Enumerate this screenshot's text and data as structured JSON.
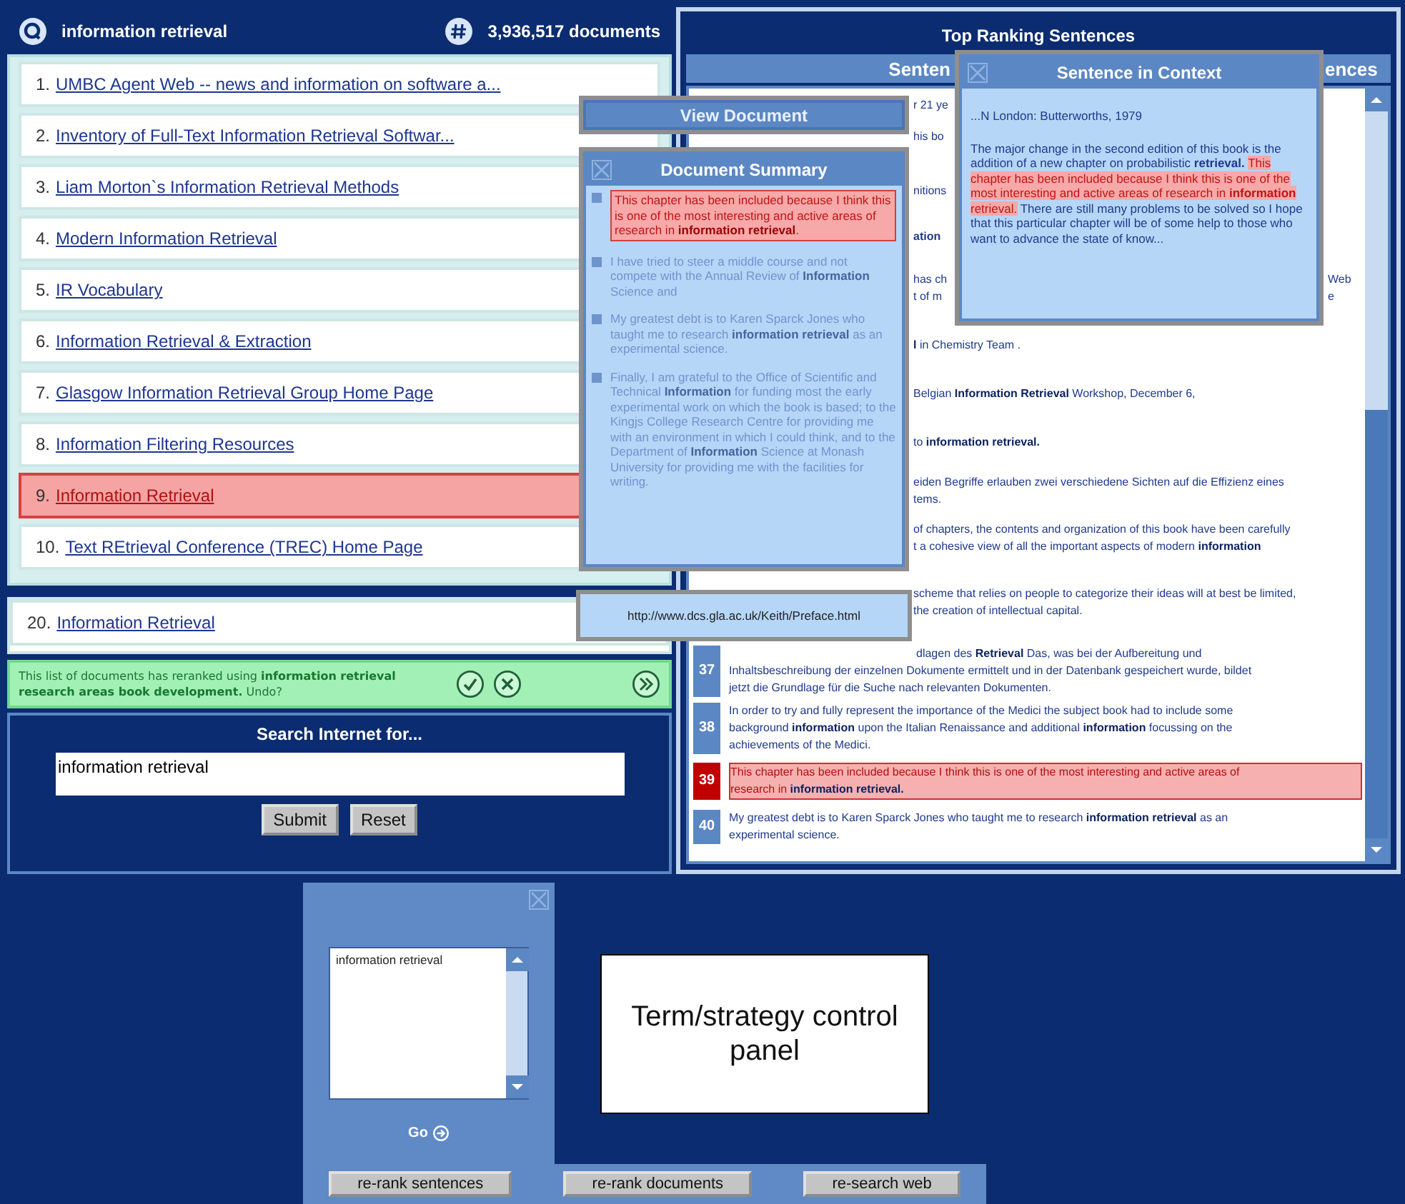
{
  "query_bar": {
    "query": "information retrieval",
    "count": "3,936,517 documents"
  },
  "results": [
    {
      "number": "1.",
      "title": "UMBC Agent Web -- news and information on software a...",
      "selected": false
    },
    {
      "number": "2.",
      "title": "Inventory of Full-Text Information Retrieval Softwar...",
      "selected": false
    },
    {
      "number": "3.",
      "title": "Liam Morton`s Information Retrieval Methods",
      "selected": false
    },
    {
      "number": "4.",
      "title": "Modern Information Retrieval",
      "selected": false
    },
    {
      "number": "5.",
      "title": "IR Vocabulary",
      "selected": false
    },
    {
      "number": "6.",
      "title": "Information Retrieval & Extraction",
      "selected": false
    },
    {
      "number": "7.",
      "title": "Glasgow Information Retrieval Group Home Page",
      "selected": false
    },
    {
      "number": "8.",
      "title": "Information Filtering Resources",
      "selected": false
    },
    {
      "number": "9.",
      "title": "Information Retrieval",
      "selected": true
    },
    {
      "number": "10.",
      "title": "Text REtrieval Conference (TREC) Home Page",
      "selected": false
    }
  ],
  "more_results": [
    {
      "number": "20.",
      "title": "Information Retrieval",
      "selected": false
    }
  ],
  "rerank_notice": {
    "text": "This list of documents has reranked using **information retrieval research areas book development.** Undo?"
  },
  "web_search": {
    "title": "Search Internet for...",
    "value": "information retrieval",
    "buttons": [
      "Submit",
      "Reset"
    ]
  },
  "top_sentences": {
    "title": "Top Ranking Sentences",
    "column_headers": [
      "Senten",
      "ences"
    ],
    "rows": [
      {
        "kind": "clipped",
        "selected": false,
        "lines": [
          "r 21 ye"
        ]
      },
      {
        "kind": "clipped",
        "selected": false,
        "lines": [
          "his bo"
        ]
      },
      {
        "kind": "clipped",
        "selected": false,
        "lines": [
          "nitions"
        ]
      },
      {
        "kind": "clipped",
        "selected": false,
        "bold": true,
        "lines": [
          "ation"
        ]
      },
      {
        "kind": "clipped",
        "selected": false,
        "lines": [
          "has ch",
          "t of m"
        ],
        "right_lines": [
          "Web",
          "e"
        ]
      },
      {
        "kind": "clipped",
        "selected": false,
        "lines": [
          "**l** in Chemistry Team ."
        ]
      },
      {
        "kind": "clipped",
        "selected": false,
        "lines": [
          "Belgian **Information Retrieval** Workshop, December 6,"
        ]
      },
      {
        "kind": "clipped",
        "selected": false,
        "lines": [
          "to **information retrieval.**"
        ]
      },
      {
        "kind": "clipped",
        "selected": false,
        "lines": [
          "eiden Begriffe erlauben zwei verschiedene Sichten auf die Effizienz eines",
          "tems."
        ]
      },
      {
        "kind": "clipped",
        "selected": false,
        "lines": [
          "of chapters, the contents and organization of this book have been carefully",
          "t a cohesive view of all the important aspects of modern **information**"
        ]
      },
      {
        "kind": "clipped",
        "selected": false,
        "lines": [
          "scheme that relies on people to categorize their ideas will at best be limited,",
          "the creation of intellectual capital."
        ]
      },
      {
        "kind": "numbered",
        "number": "37",
        "selected": false,
        "first_line_clipped": true,
        "lines": [
          "dlagen des **Retrieval** Das, was bei der Aufbereitung und",
          "Inhaltsbeschreibung der einzelnen Dokumente ermittelt und in der Datenbank gespeichert wurde, bildet",
          "jetzt die Grundlage für die Suche nach relevanten Dokumenten."
        ]
      },
      {
        "kind": "numbered",
        "number": "38",
        "selected": false,
        "lines": [
          "In order to try and fully represent the importance of the Medici the subject book had to include some",
          "background **information** upon the Italian Renaissance and additional **information** focussing on the",
          "achievements of the Medici."
        ]
      },
      {
        "kind": "numbered",
        "number": "39",
        "selected": true,
        "lines": [
          "This chapter has been included because I think this is one of the most interesting and active areas of",
          "research in **information retrieval.**"
        ]
      },
      {
        "kind": "numbered",
        "number": "40",
        "selected": false,
        "lines": [
          "My greatest debt is to Karen Sparck Jones who taught me to research **information retrieval** as an",
          "experimental science."
        ]
      }
    ]
  },
  "view_document": {
    "label": "View Document"
  },
  "document_summary": {
    "title": "Document Summary",
    "items": [
      {
        "text": "This chapter has been included because I think this is one of the most interesting and active areas of research in **information retrieval**.",
        "selected": true
      },
      {
        "text": "I have tried to steer a middle course and not compete with the Annual Review of **Information** Science and",
        "selected": false
      },
      {
        "text": "My greatest debt is to Karen Sparck Jones who taught me to research **information retrieval** as an experimental science.",
        "selected": false
      },
      {
        "text": "Finally, I am grateful to the Office of Scientific and Technical **Information** for funding most the early experimental work on which the book is based; to the Kingjs College Research Centre for providing me with an environment in which I could think, and to the Department of **Information** Science at Monash University for providing me with the facilities for writing.",
        "selected": false
      }
    ]
  },
  "document_url": "http://www.dcs.gla.ac.uk/Keith/Preface.html",
  "sentence_context": {
    "title": "Sentence in Context",
    "lead": "...N London: Butterworths, 1979",
    "segments": [
      {
        "text": "The major change in the second edition of this book is the addition of a new chapter on probabilistic **retrieval.**",
        "highlighted": false
      },
      {
        "text": "This chapter has been included because I think this is one of the most interesting and active areas of research in **information** retrieval.",
        "highlighted": true
      },
      {
        "text": "There are still many problems to be solved so I hope that this particular chapter will be of some help to those who want to advance the state of know...",
        "highlighted": false
      }
    ]
  },
  "term_panel": {
    "terms": [
      "information retrieval"
    ],
    "go_label": "Go",
    "buttons": [
      "re-rank sentences",
      "re-rank documents",
      "re-search web"
    ]
  },
  "annotation": "Term/strategy control panel"
}
